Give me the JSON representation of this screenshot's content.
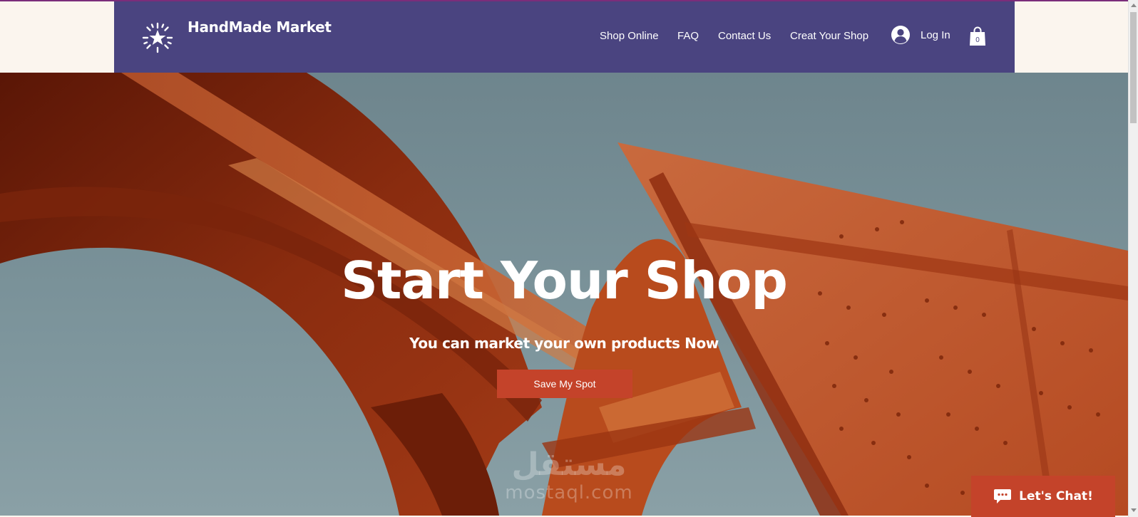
{
  "header": {
    "brand": "HandMade Market",
    "logo_icon": "starburst-icon",
    "nav": [
      "Shop Online",
      "FAQ",
      "Contact Us",
      "Creat Your Shop"
    ],
    "login_label": "Log In",
    "cart_count": "0"
  },
  "hero": {
    "title": "Start Your Shop",
    "subtitle": "You can market your own products Now",
    "cta_label": "Save My Spot"
  },
  "watermark": {
    "arabic": "مستقل",
    "latin": "mostaql.com"
  },
  "chat": {
    "label": "Let's Chat!"
  },
  "colors": {
    "header_bg": "#4a4480",
    "accent": "#c4432a",
    "page_bg": "#fbf5ee",
    "sky": "#7a9298",
    "steel": "#c4602f"
  }
}
